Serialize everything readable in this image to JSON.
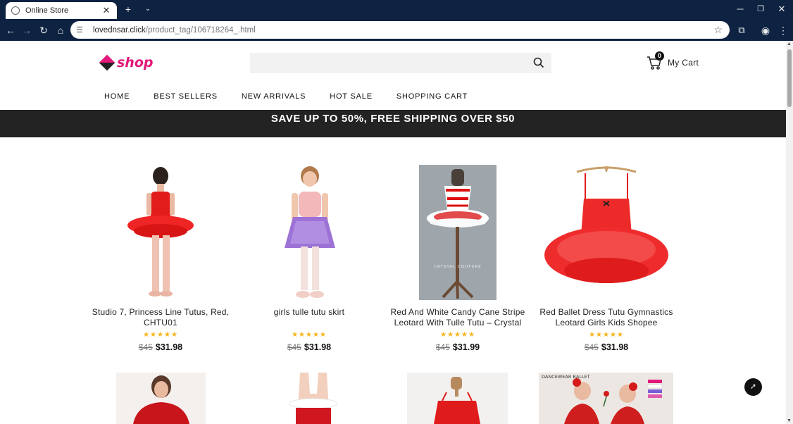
{
  "browser": {
    "tab_title": "Online Store",
    "url_host": "lovednsar.click",
    "url_path": "/product_tag/106718264_.html"
  },
  "header": {
    "logo_text": "shop",
    "search_placeholder": "",
    "cart_count": "0",
    "cart_label": "My Cart"
  },
  "menu": [
    {
      "label": "HOME"
    },
    {
      "label": "BEST SELLERS"
    },
    {
      "label": "NEW ARRIVALS"
    },
    {
      "label": "HOT SALE"
    },
    {
      "label": "SHOPPING CART"
    }
  ],
  "promo": "SAVE UP TO 50%, FREE SHIPPING OVER $50",
  "products": [
    {
      "title": "Studio 7, Princess Line Tutus, Red, CHTU01",
      "stars": "★★★★★",
      "old_price": "$45",
      "price": "$31.98"
    },
    {
      "title": "girls tulle tutu skirt",
      "stars": "★★★★★",
      "old_price": "$45",
      "price": "$31.98"
    },
    {
      "title": "Red And White Candy Cane Stripe Leotard With Tulle Tutu – Crystal",
      "stars": "★★★★★",
      "old_price": "$45",
      "price": "$31.99"
    },
    {
      "title": "Red Ballet Dress Tutu Gymnastics Leotard Girls Kids Shopee",
      "stars": "★★★★★",
      "old_price": "$45",
      "price": "$31.98"
    }
  ],
  "image_text": {
    "crystal_couture": "CRYSTAL COUTURE",
    "dancewear_ballet": "DANCEWEAR BALLET"
  },
  "colors": {
    "brand": "#e2197a",
    "promo_bg": "#232323",
    "stars": "#f4b51c",
    "chrome": "#0e2341"
  }
}
